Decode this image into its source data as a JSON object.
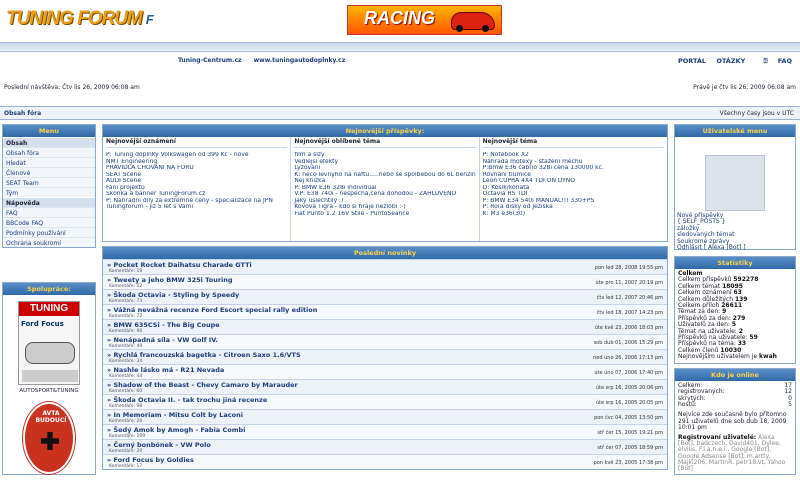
{
  "site": {
    "logo": "TUNING FORUM",
    "logo_mark": "F",
    "banner_text": "RACING"
  },
  "extlinks": [
    "Tuning-Centrum.cz",
    "www.tuningautodoplnky.cz"
  ],
  "nav": {
    "portal": "PORTÁL",
    "faq_questions": "OTÁZKY",
    "faq": "FAQ"
  },
  "visit": {
    "last_visit": "Poslední návštěva: Čtv lis 26, 2009 06:08 am",
    "now": "Právě je čtv lis 26, 2009 06:08 am"
  },
  "breadcrumb": {
    "home": "Obsah fóra",
    "timezone": "Všechny časy jsou v UTC"
  },
  "left_menu": {
    "title": "Menu",
    "sections": [
      {
        "label": "Obsah",
        "items": [
          "Obsah fóra",
          "Hledat",
          "Členové",
          "SEAT Team",
          "Tým"
        ]
      },
      {
        "label": "Nápověda",
        "items": [
          "FAQ",
          "BBCode FAQ",
          "Podmínky používání",
          "Ochrana soukromí"
        ]
      }
    ]
  },
  "partners": {
    "title": "Spolupráce:",
    "mag_title": "TUNING",
    "mag_sub": "Ford Focus",
    "mag_caption": "AUTOSPORT&TUNING",
    "sticker_text": "AVTA BUDOUCÍ"
  },
  "newest_posts": {
    "title": "Nejnovější příspěvky:",
    "columns": [
      {
        "heading": "Nejnovější oznámení",
        "lines": [
          "P: Tuning doplňky Volkswagen od 399 Kč - nové",
          "NMT Engineering",
          "PRAVIDLA CHOVÁNÍ NA FÓRU",
          "SEAT Scene",
          "AUDI Scene",
          "Fáni projektů",
          "Skonka a banner TuningForum.cz",
          "P: Náhradní díly za extrémně ceny - specializace na JPN",
          "Tuningforum - již 5 let s Vámi"
        ]
      },
      {
        "heading": "Nejnovější oblíbené téma",
        "lines": [
          "film a slzy",
          "Vedlejší efekty",
          "Lyžování",
          "K: něco levnýho na naftu.....nebo se spolbebou do 6L benzínu",
          "Nej knížka",
          "P: BMW E36 328i individual",
          "V.P: E38 740i - nespěchá,cena dohodou - ZAHLUVENO",
          "Jaký ušlechtilý :)",
          "Kovova Tigra - kdo si hraje nezlobí :-)",
          "Fiat Punto 1.2 16V Stile - PuntoSeance"
        ]
      },
      {
        "heading": "Nejnovější téma",
        "lines": [
          "P: Notebook X2",
          "Náhrada motexy - stažení měchu",
          "P:Bmw E36 cabrio 328i cena 130000 kč.",
          "Rovnání tlumiče",
          "Leon CUPRA 4X4 TDI ON DYNO",
          "D: Košík/koňata",
          "Octavia RS TDI",
          "P: BMW E34 540i MANUÁL!!! 330+PS",
          "P: Roľa disky od Ježiška",
          "K: M3 e36(30)"
        ]
      }
    ]
  },
  "news": {
    "title": "Poslední novinky",
    "items": [
      {
        "title": "» Pocket Rocket Daihatsu Charade GTTi",
        "comments": "Komentáře: 19",
        "date": "pon led 28, 2008 19:55 pm"
      },
      {
        "title": "» Tweety a jeho BMW 325i Touring",
        "comments": "Komentáře: 12",
        "date": "úte pro 11, 2007 20:19 pm"
      },
      {
        "title": "» Škoda Octavia - Styling by Speedy",
        "comments": "Komentáře: 73",
        "date": "čtv led 12, 2007 20:46 pm"
      },
      {
        "title": "» Vážná nevážná recenze Ford Escort special rally edition",
        "comments": "Komentáře: 72",
        "date": "čtv led 18, 2007 14:23 pm"
      },
      {
        "title": "» BMW 635CSi - The Big Coupe",
        "comments": "Komentáře: 96",
        "date": "úte kvě 23, 2006 18:03 pm"
      },
      {
        "title": "» Nenápadná síla - VW Golf IV.",
        "comments": "Komentáře: 49",
        "date": "sob dub 01, 2006 15:29 pm"
      },
      {
        "title": "» Rychlá francouzská bagetka - Citroen Saxo 1.6/VTS",
        "comments": "Komentáře: 34",
        "date": "ned úno 26, 2006 17:13 pm"
      },
      {
        "title": "» Nashle lásko má - R21 Nevada",
        "comments": "Komentáře: 44",
        "date": "úte úno 07, 2006 17:40 pm"
      },
      {
        "title": "» Shadow of the Beast - Chevy Camaro by Marauder",
        "comments": "Komentáře: 60",
        "date": "úte srp 16, 2005 20:06 pm"
      },
      {
        "title": "» Škoda Octavia II. - tak trochu jiná recenze",
        "comments": "Komentáře: 98",
        "date": "úte srp 16, 2005 20:05 pm"
      },
      {
        "title": "» In Memoriam - Mitsu Colt by Laconi",
        "comments": "Komentáře: 26",
        "date": "pon čvc 04, 2005 13:50 pm"
      },
      {
        "title": "» Šedý Amok by Amogh - Fabia Combi",
        "comments": "Komentáře: 109",
        "date": "stř čer 15, 2005 19:21 pm"
      },
      {
        "title": "» Černý bonbónek - VW Polo",
        "comments": "Komentáře: 20",
        "date": "stř čer 07, 2005 18:59 pm"
      },
      {
        "title": "» Ford Focus by Goldies",
        "comments": "Komentáře: 17",
        "date": "pon kvě 23, 2005 17:38 pm"
      }
    ]
  },
  "user_menu": {
    "title": "Uživatelské menu",
    "links": [
      "Nové příspěvky",
      "{ SELF_POSTS }",
      "záložky",
      "sledovaných témat",
      "Soukromé zprávy",
      "Odhlásit [ Alexa [Bot] ]"
    ]
  },
  "stats": {
    "title": "Statistiky",
    "heading": "Celkem",
    "rows": [
      {
        "label": "Celkem příspěvků",
        "value": "592278"
      },
      {
        "label": "Celkem témat",
        "value": "18095"
      },
      {
        "label": "Celkem oznámení",
        "value": "63"
      },
      {
        "label": "Celkem důležitých",
        "value": "139"
      },
      {
        "label": "Celkem příloh",
        "value": "26611"
      },
      {
        "label": "Témat za den:",
        "value": "9"
      },
      {
        "label": "Příspěvků za den:",
        "value": "279"
      },
      {
        "label": "Uživatelů za den:",
        "value": "5"
      },
      {
        "label": "Témat na uživatele:",
        "value": "2"
      },
      {
        "label": "Příspěvků na uživatele:",
        "value": "59"
      },
      {
        "label": "Příspěvků na téma:",
        "value": "33"
      },
      {
        "label": "Celkem členů",
        "value": "10030"
      },
      {
        "label": "Nejnovějším uživatelem je",
        "value": "kwah"
      }
    ]
  },
  "online": {
    "title": "Kdo je online",
    "rows": [
      {
        "label": "Celkem:",
        "value": "17"
      },
      {
        "label": "registrovaných:",
        "value": "12"
      },
      {
        "label": "skrytých:",
        "value": "0"
      },
      {
        "label": "hostů:",
        "value": "5"
      }
    ],
    "record_text": "Nejvíce zde současně bylo přítomno 291 uživatelů dne sob dub 18, 2009 10:01 pm",
    "registered_label": "Registrovaní uživatelé:",
    "registered_list": "Alexa [Bot], badczech, David401, Dylee, elvilis, F.I.a.n.e.i., Google [Bot], Google Adsense [Bot], m.artty, Majki206, MartinR, petr18.vt, Yahoo [Bot]"
  }
}
